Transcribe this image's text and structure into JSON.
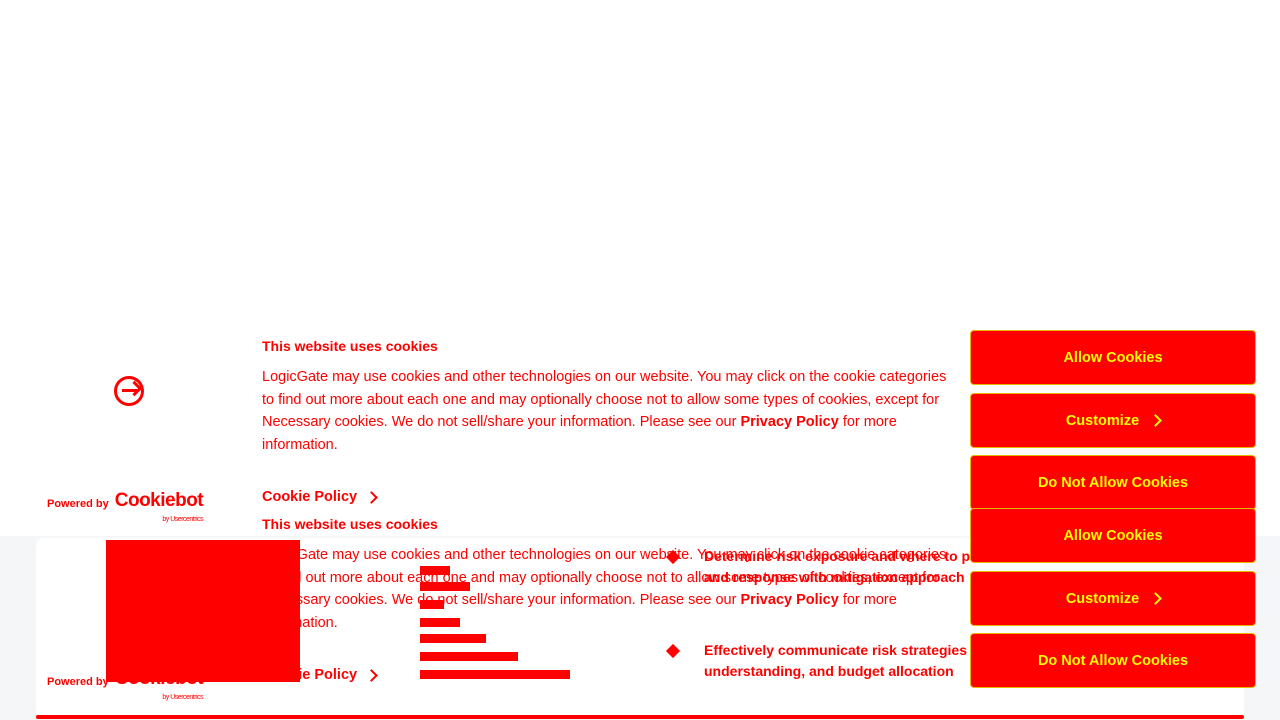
{
  "background": {
    "bullets": [
      "Determine risk exposure and where to prioritize investment and response with mitigation approach",
      "Effectively communicate risk strategies to gain buy-in, understanding, and budget allocation"
    ]
  },
  "cookie_banner": {
    "title": "This website uses cookies",
    "body_before_link": "LogicGate may use cookies and other technologies on our website. You may click on the cookie categories to find out more about each one and may optionally choose not to allow some types of cookies, except for Necessary cookies.  We do not sell/share your information. Please see our ",
    "privacy_link": "Privacy Policy",
    "body_after_link": " for more information.",
    "cookie_policy_link": "Cookie Policy",
    "powered_by": "Powered by",
    "brand": "Cookiebot",
    "brand_sub": "by Usercentrics",
    "buttons": {
      "allow": "Allow Cookies",
      "customize": "Customize",
      "deny": "Do Not Allow Cookies"
    }
  },
  "colors": {
    "accent": "#ff0000",
    "button_text": "#ffff00"
  }
}
